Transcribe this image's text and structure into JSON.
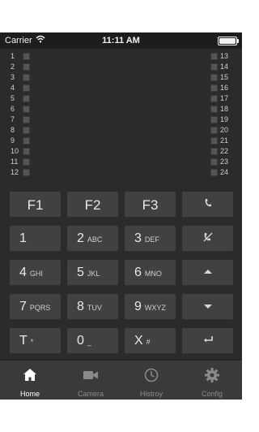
{
  "status": {
    "carrier": "Carrier",
    "time": "11:11 AM"
  },
  "indicators": {
    "left": [
      "1",
      "2",
      "3",
      "4",
      "5",
      "6",
      "7",
      "8",
      "9",
      "10",
      "11",
      "12"
    ],
    "right": [
      "13",
      "14",
      "15",
      "16",
      "17",
      "18",
      "19",
      "20",
      "21",
      "22",
      "23",
      "24"
    ]
  },
  "keys": {
    "f1": "F1",
    "f2": "F2",
    "f3": "F3",
    "k1": {
      "main": "1",
      "sub": ""
    },
    "k2": {
      "main": "2",
      "sub": "ABC"
    },
    "k3": {
      "main": "3",
      "sub": "DEF"
    },
    "k4": {
      "main": "4",
      "sub": "GHI"
    },
    "k5": {
      "main": "5",
      "sub": "JKL"
    },
    "k6": {
      "main": "6",
      "sub": "MNO"
    },
    "k7": {
      "main": "7",
      "sub": "PQRS"
    },
    "k8": {
      "main": "8",
      "sub": "TUV"
    },
    "k9": {
      "main": "9",
      "sub": "WXYZ"
    },
    "kt": {
      "main": "T",
      "sub": "*"
    },
    "k0": {
      "main": "0",
      "sub": "_"
    },
    "kx": {
      "main": "X",
      "sub": "#"
    }
  },
  "icons": {
    "call": "phone-icon",
    "hangup": "hangup-icon",
    "up": "arrow-up-icon",
    "down": "arrow-down-icon",
    "enter": "enter-icon"
  },
  "tabs": [
    {
      "label": "Home",
      "icon": "home-icon"
    },
    {
      "label": "Camera",
      "icon": "camera-icon"
    },
    {
      "label": "Histroy",
      "icon": "clock-icon"
    },
    {
      "label": "Config",
      "icon": "gear-icon"
    }
  ],
  "colors": {
    "background": "#2b2b2b",
    "key": "#414141",
    "tabbar": "#3a3a3a",
    "active_tab": "#ffffff",
    "inactive_tab": "#8b8b8b"
  }
}
